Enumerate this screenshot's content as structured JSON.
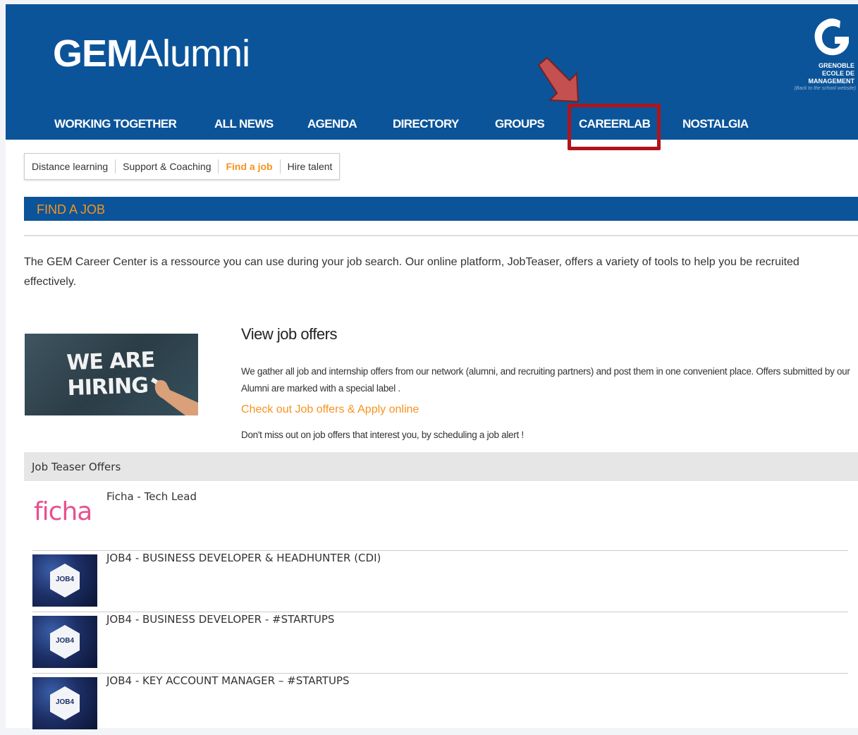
{
  "header": {
    "brand_bold": "GEM",
    "brand_light": "Alumni",
    "school_name": "GRENOBLE\nECOLE DE\nMANAGEMENT",
    "school_back": "(Back to the school website)"
  },
  "nav": [
    {
      "label": "WORKING TOGETHER"
    },
    {
      "label": "ALL NEWS"
    },
    {
      "label": "AGENDA"
    },
    {
      "label": "DIRECTORY"
    },
    {
      "label": "GROUPS"
    },
    {
      "label": "CAREERLAB",
      "highlighted": true
    },
    {
      "label": "NOSTALGIA"
    }
  ],
  "subnav": [
    {
      "label": "Distance learning"
    },
    {
      "label": "Support & Coaching"
    },
    {
      "label": "Find a job",
      "active": true
    },
    {
      "label": "Hire talent"
    }
  ],
  "section": {
    "title": "FIND A JOB"
  },
  "intro": "The GEM Career Center is a ressource you can use during your job search. Our online platform, JobTeaser, offers a variety of tools to help you be recruited effectively.",
  "offers": {
    "image_text": "WE ARE\nHIRING",
    "title": "View job offers",
    "description": "We gather all job and internship offers from our network (alumni, and recruiting partners) and post them in one convenient place. Offers submitted by our Alumni are marked with a special label .",
    "link": "Check out Job offers & Apply online",
    "alert": "Don't miss out on job offers that interest you, by scheduling a job alert !"
  },
  "job_teaser": {
    "header": "Job Teaser Offers",
    "jobs": [
      {
        "title": "Ficha - Tech Lead",
        "logo_text": "ficha"
      },
      {
        "title": "JOB4 - BUSINESS DEVELOPER & HEADHUNTER (CDI)",
        "logo_text": "JOB4"
      },
      {
        "title": "JOB4 - BUSINESS DEVELOPER - #STARTUPS",
        "logo_text": "JOB4"
      },
      {
        "title": "JOB4 - KEY ACCOUNT MANAGER – #STARTUPS",
        "logo_text": "JOB4"
      }
    ]
  },
  "colors": {
    "header_blue": "#0b5499",
    "accent_orange": "#f7931e",
    "highlight_red": "#b0141b",
    "ficha_pink": "#e8508f"
  }
}
